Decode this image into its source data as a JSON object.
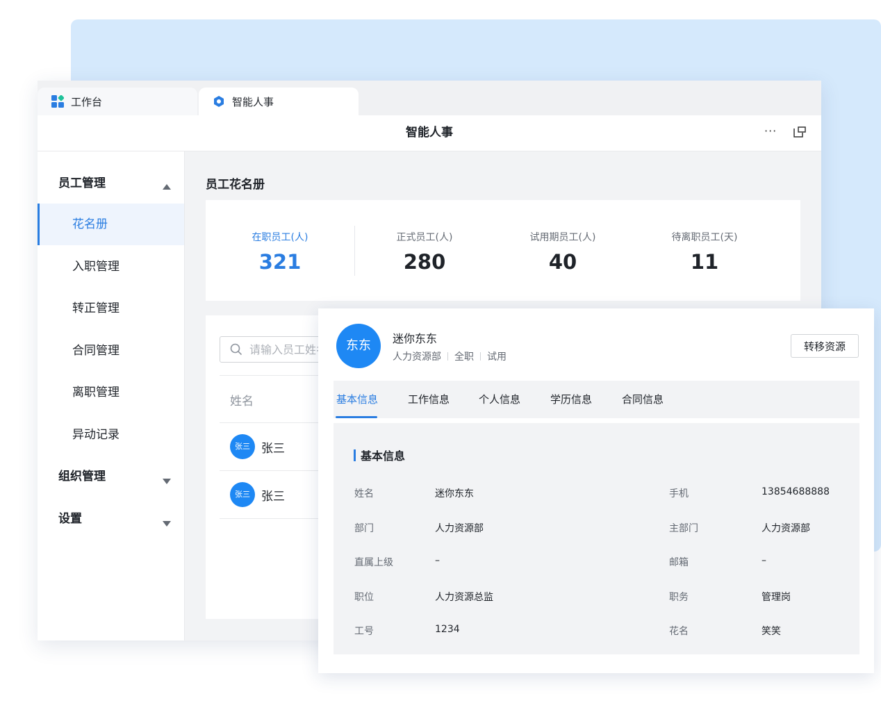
{
  "tabs": [
    {
      "label": "工作台",
      "icon": "grid-apps-icon"
    },
    {
      "label": "智能人事",
      "icon": "gear-icon"
    }
  ],
  "window": {
    "title": "智能人事",
    "more_label": "···"
  },
  "sidebar": {
    "groups": [
      {
        "label": "员工管理",
        "expanded": true
      },
      {
        "label": "组织管理",
        "expanded": false
      },
      {
        "label": "设置",
        "expanded": false
      }
    ],
    "items": [
      {
        "label": "花名册",
        "active": true
      },
      {
        "label": "入职管理"
      },
      {
        "label": "转正管理"
      },
      {
        "label": "合同管理"
      },
      {
        "label": "离职管理"
      },
      {
        "label": "异动记录"
      }
    ]
  },
  "main": {
    "heading": "员工花名册",
    "stats": [
      {
        "label": "在职员工(人)",
        "value": "321"
      },
      {
        "label": "正式员工(人)",
        "value": "280"
      },
      {
        "label": "试用期员工(人)",
        "value": "40"
      },
      {
        "label": "待离职员工(天)",
        "value": "11"
      }
    ],
    "search_placeholder": "请输入员工姓名",
    "table": {
      "column_name": "姓名",
      "rows": [
        {
          "avatar": "张三",
          "name": "张三"
        },
        {
          "avatar": "张三",
          "name": "张三"
        }
      ]
    }
  },
  "detail": {
    "avatar": "东东",
    "name": "迷你东东",
    "meta": [
      "人力资源部",
      "全职",
      "试用"
    ],
    "transfer_label": "转移资源",
    "tabs": [
      "基本信息",
      "工作信息",
      "个人信息",
      "学历信息",
      "合同信息"
    ],
    "section_title": "基本信息",
    "fields_left": [
      {
        "label": "姓名",
        "value": "迷你东东"
      },
      {
        "label": "部门",
        "value": "人力资源部"
      },
      {
        "label": "直属上级",
        "value": "–"
      },
      {
        "label": "职位",
        "value": "人力资源总监"
      },
      {
        "label": "工号",
        "value": "1234"
      }
    ],
    "fields_right": [
      {
        "label": "手机",
        "value": "13854688888"
      },
      {
        "label": "主部门",
        "value": "人力资源部"
      },
      {
        "label": "邮箱",
        "value": "–"
      },
      {
        "label": "职务",
        "value": "管理岗"
      },
      {
        "label": "花名",
        "value": "笑笑"
      }
    ]
  },
  "colors": {
    "accent": "#2a7de1",
    "avatar": "#1e88f4",
    "bg_panel": "#d5e9fc"
  }
}
